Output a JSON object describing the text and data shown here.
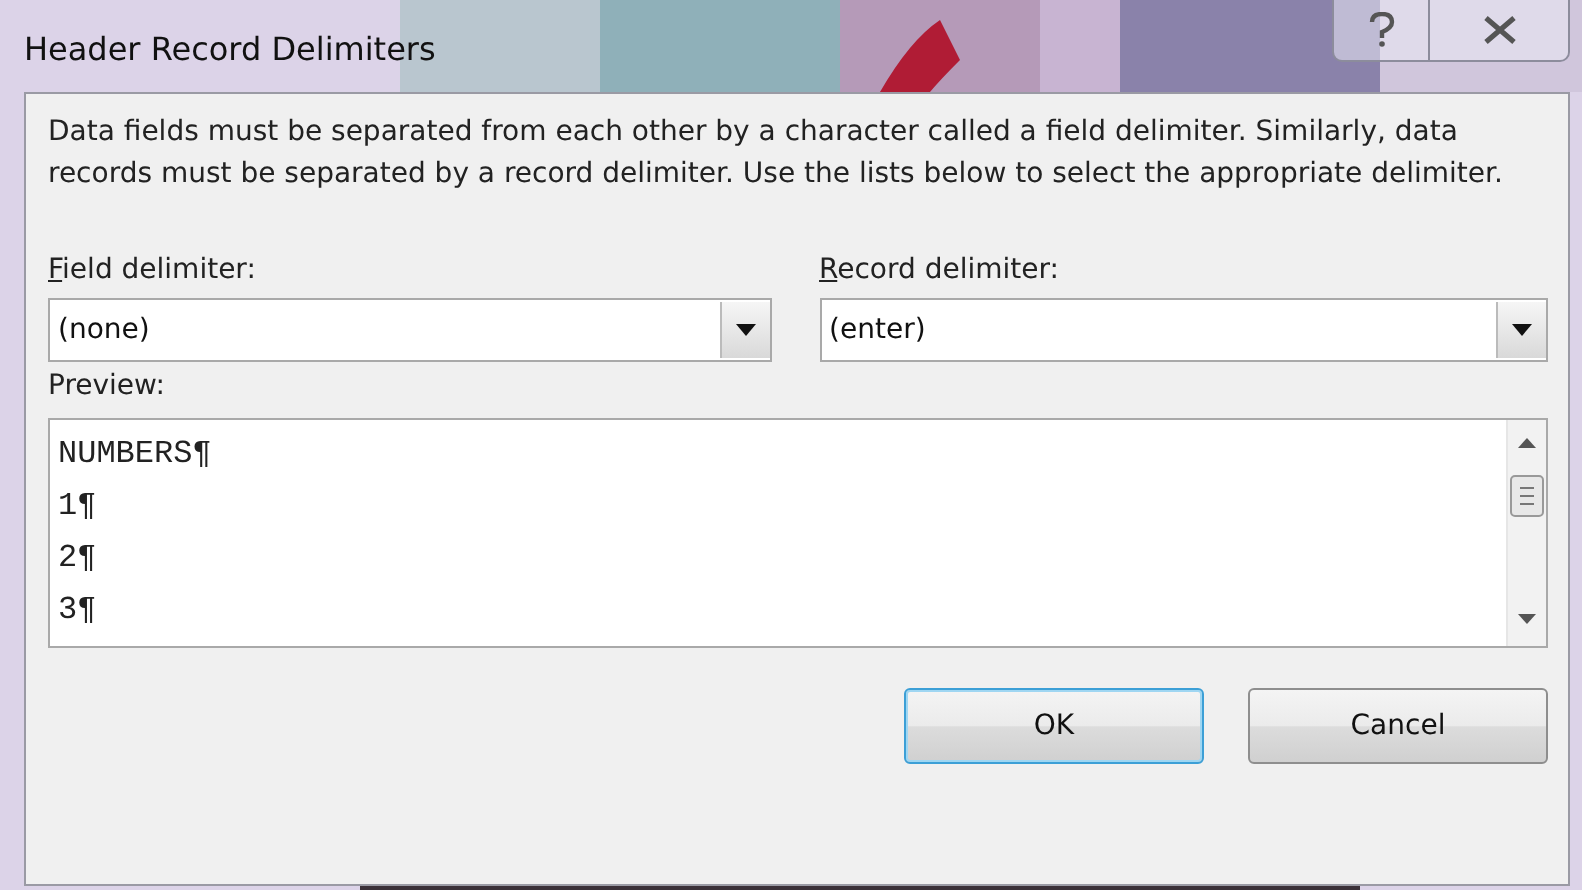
{
  "window": {
    "title": "Header Record Delimiters"
  },
  "description": "Data fields must be separated from each other by a character called a field delimiter. Similarly, data records must be separated by a record delimiter.  Use the lists below to select the appropriate delimiter.",
  "field_delimiter": {
    "label": "Field delimiter:",
    "value": "(none)"
  },
  "record_delimiter": {
    "label": "Record delimiter:",
    "value": "(enter)"
  },
  "preview": {
    "label": "Preview:",
    "lines": [
      "NUMBERS¶",
      "1¶",
      "2¶",
      "3¶"
    ]
  },
  "buttons": [
    {
      "label": "OK",
      "default": true
    },
    {
      "label": "Cancel",
      "default": false
    }
  ]
}
